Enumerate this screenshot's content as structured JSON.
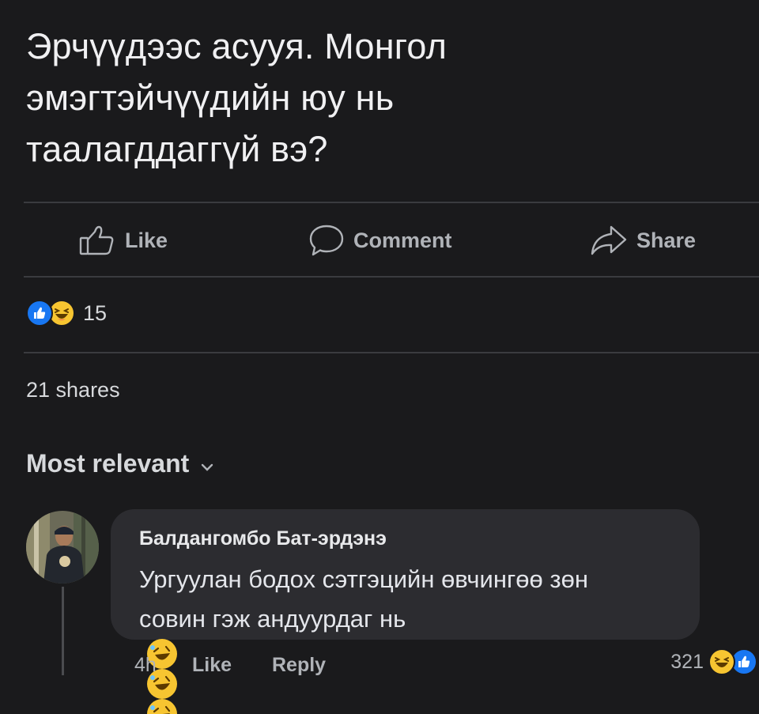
{
  "post": {
    "text_lines": [
      "Эрчүүдээс асууя. Монгол",
      "эмэгтэйчүүдийн юу нь",
      "таалагддаггүй вэ?"
    ]
  },
  "actions": {
    "like": "Like",
    "comment": "Comment",
    "share": "Share"
  },
  "reactions": {
    "icons": [
      "like-icon",
      "haha-icon"
    ],
    "count": "15"
  },
  "shares": "21 shares",
  "sort": {
    "label": "Most relevant"
  },
  "comment": {
    "author": "Балдангомбо Бат-эрдэнэ",
    "text_lines": [
      "Ургуулан бодох сэтгэцийн өвчингөө зөн",
      "совин гэж андуурдаг нь"
    ],
    "emojis": [
      "rofl-icon",
      "rofl-icon",
      "rofl-icon"
    ],
    "time": "4h",
    "like": "Like",
    "reply": "Reply",
    "reaction_count": "321",
    "reaction_icons": [
      "haha-icon",
      "like-icon"
    ]
  },
  "colors": {
    "background": "#1a1a1c",
    "bubble": "#2c2c30",
    "like_blue": "#1877f2",
    "haha_yellow": "#f7c531",
    "secondary_text": "#b0b3b8"
  }
}
